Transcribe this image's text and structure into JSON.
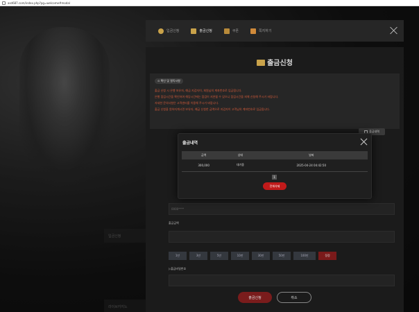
{
  "browser": {
    "url": "asd687.com/index.php?pg=welcome#modal"
  },
  "background": {
    "tiles": [
      {
        "label": "입금신청"
      },
      {
        "label": "라이브카지노"
      }
    ]
  },
  "topnav": {
    "items": [
      {
        "label": "입금신청",
        "icon": "money-bag-icon"
      },
      {
        "label": "출금신청",
        "icon": "wallet-icon",
        "active": true
      },
      {
        "label": "쿠폰",
        "icon": "coupon-icon"
      },
      {
        "label": "쪽지하기",
        "icon": "message-icon"
      }
    ]
  },
  "panel": {
    "title": "출금신청",
    "notice": {
      "heading": "⊙ 확인 및 필독사항",
      "lines": [
        "출금 신청 시 은행 보유자, 예금 지갑자이, 회원님의 계좌번호로 입금됩니다.",
        "은행 점검시간을 확인하여 해당시간에는 점검이 지연될 수 있으니 점검시간을 피해 신청해 주시기 바랍니다.",
        "자세한 문의사항은 고객센터를 이용해 주시기 바랍니다.",
        "출금 신청을 원하지계시면 보유자, 예금 신청한 금액으로 지갑자이 고객님의 계좌번호로 입금됩니다."
      ]
    },
    "history_button_label": "출금내역",
    "account_placeholder": "0000****",
    "amount_label": "출금금액",
    "amount_buttons": [
      "1만",
      "3만",
      "5만",
      "10만",
      "30만",
      "50만",
      "100만",
      "정정"
    ],
    "password_label": "▷출금비밀번호",
    "submit_label": "출금신청",
    "cancel_label": "취소"
  },
  "history_modal": {
    "title": "출금내역",
    "columns": [
      "금액",
      "상태",
      "날짜"
    ],
    "rows": [
      {
        "amount": "300,000",
        "status": "대기중",
        "date": "2025-04-24 04:42:50"
      }
    ],
    "page": "1",
    "delete_label": "전체삭제"
  },
  "colors": {
    "accent_gold": "#c9a24a",
    "alert_red": "#c01a1a",
    "notice_text": "#d55b3a"
  }
}
